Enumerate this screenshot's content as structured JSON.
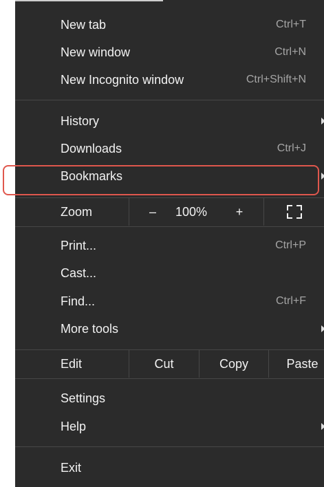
{
  "menu": {
    "new_tab": {
      "label": "New tab",
      "shortcut": "Ctrl+T"
    },
    "new_window": {
      "label": "New window",
      "shortcut": "Ctrl+N"
    },
    "new_incognito": {
      "label": "New Incognito window",
      "shortcut": "Ctrl+Shift+N"
    },
    "history": {
      "label": "History"
    },
    "downloads": {
      "label": "Downloads",
      "shortcut": "Ctrl+J"
    },
    "bookmarks": {
      "label": "Bookmarks"
    },
    "zoom": {
      "label": "Zoom",
      "minus": "–",
      "level": "100%",
      "plus": "+"
    },
    "print": {
      "label": "Print...",
      "shortcut": "Ctrl+P"
    },
    "cast": {
      "label": "Cast..."
    },
    "find": {
      "label": "Find...",
      "shortcut": "Ctrl+F"
    },
    "more_tools": {
      "label": "More tools"
    },
    "edit": {
      "label": "Edit",
      "cut": "Cut",
      "copy": "Copy",
      "paste": "Paste"
    },
    "settings": {
      "label": "Settings"
    },
    "help": {
      "label": "Help"
    },
    "exit": {
      "label": "Exit"
    }
  },
  "colors": {
    "menu_background": "#2b2b2b",
    "text": "#f2f2f2",
    "shortcut_text": "#a5a5a5",
    "highlight_border": "#e0574d",
    "separator": "#474747"
  }
}
